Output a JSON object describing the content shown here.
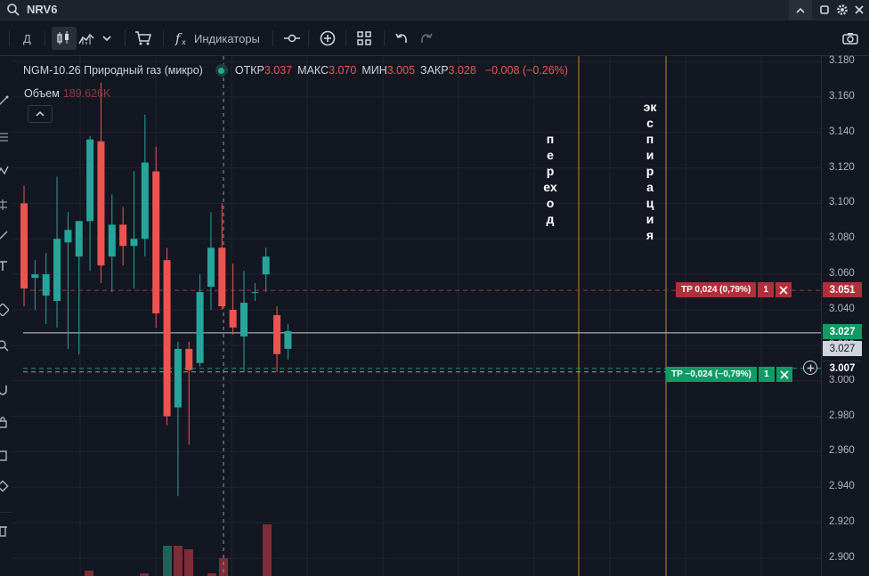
{
  "search": {
    "ticker": "NRV6"
  },
  "toolbar": {
    "interval_label": "Д",
    "indicators_label": "Индикаторы"
  },
  "legend": {
    "instrument": "NGM-10.26 Природный газ (микро)",
    "open_label": "ОТКР",
    "open_value": "3.037",
    "high_label": "МАКС",
    "high_value": "3.070",
    "low_label": "МИН",
    "low_value": "3.005",
    "close_label": "ЗАКР",
    "close_value": "3.028",
    "change": "−0.008 (−0.26%)",
    "volume_label": "Объем",
    "volume_value": "189.626K"
  },
  "annotations": {
    "transition": "переход",
    "expiration": "экспирация"
  },
  "orders": {
    "tp_upper_label": "TP 0,024 (0,79%)",
    "tp_upper_qty": "1",
    "tp_upper_price": "3.051",
    "tp_lower_label": "TP −0,024 (−0,79%)",
    "tp_lower_qty": "1",
    "tp_lower_price": "3.007"
  },
  "price_axis": {
    "ticks": [
      "3.180",
      "3.160",
      "3.140",
      "3.120",
      "3.100",
      "3.080",
      "3.060",
      "3.040",
      "3.020",
      "3.000",
      "2.980",
      "2.960",
      "2.940",
      "2.920",
      "2.900"
    ],
    "last_price": "3.027",
    "crosshair_price": "3.027"
  },
  "colors": {
    "up": "#26a69a",
    "down": "#ef5350",
    "background": "#131722",
    "grid": "#1f2430",
    "transition_line": "#c48a1a",
    "expiration_line": "#c48a1a"
  },
  "chart_data": {
    "type": "candlestick",
    "ylim": [
      2.89,
      3.19
    ],
    "candles": [
      {
        "o": 3.1,
        "h": 3.11,
        "l": 3.042,
        "c": 3.052
      },
      {
        "o": 3.058,
        "h": 3.068,
        "l": 3.04,
        "c": 3.06
      },
      {
        "o": 3.048,
        "h": 3.072,
        "l": 3.032,
        "c": 3.06
      },
      {
        "o": 3.045,
        "h": 3.115,
        "l": 3.03,
        "c": 3.08
      },
      {
        "o": 3.078,
        "h": 3.095,
        "l": 3.018,
        "c": 3.085
      },
      {
        "o": 3.07,
        "h": 3.09,
        "l": 3.015,
        "c": 3.09
      },
      {
        "o": 3.09,
        "h": 3.138,
        "l": 3.062,
        "c": 3.136
      },
      {
        "o": 3.135,
        "h": 3.168,
        "l": 3.055,
        "c": 3.065
      },
      {
        "o": 3.07,
        "h": 3.105,
        "l": 3.05,
        "c": 3.088
      },
      {
        "o": 3.088,
        "h": 3.098,
        "l": 3.065,
        "c": 3.076
      },
      {
        "o": 3.076,
        "h": 3.118,
        "l": 3.052,
        "c": 3.08
      },
      {
        "o": 3.08,
        "h": 3.15,
        "l": 3.07,
        "c": 3.123
      },
      {
        "o": 3.118,
        "h": 3.132,
        "l": 3.03,
        "c": 3.038
      },
      {
        "o": 3.068,
        "h": 3.075,
        "l": 2.975,
        "c": 2.98
      },
      {
        "o": 2.985,
        "h": 3.022,
        "l": 2.935,
        "c": 3.018
      },
      {
        "o": 3.018,
        "h": 3.022,
        "l": 2.964,
        "c": 3.006
      },
      {
        "o": 3.01,
        "h": 3.06,
        "l": 3.008,
        "c": 3.05
      },
      {
        "o": 3.053,
        "h": 3.095,
        "l": 3.04,
        "c": 3.075
      },
      {
        "o": 3.075,
        "h": 3.1,
        "l": 3.04,
        "c": 3.042
      },
      {
        "o": 3.04,
        "h": 3.066,
        "l": 3.026,
        "c": 3.03
      },
      {
        "o": 3.025,
        "h": 3.062,
        "l": 3.005,
        "c": 3.044
      },
      {
        "o": 3.05,
        "h": 3.055,
        "l": 3.045,
        "c": 3.05
      },
      {
        "o": 3.06,
        "h": 3.075,
        "l": 3.05,
        "c": 3.07
      },
      {
        "o": 3.037,
        "h": 3.042,
        "l": 3.005,
        "c": 3.015
      },
      {
        "o": 3.018,
        "h": 3.032,
        "l": 3.012,
        "c": 3.028
      }
    ],
    "price_lines": [
      {
        "name": "tp-upper",
        "price": 3.051,
        "style": "dashed"
      },
      {
        "name": "last-price",
        "price": 3.027,
        "style": "solid"
      },
      {
        "name": "tp-lower",
        "price": 3.007,
        "style": "dashed"
      },
      {
        "name": "entry",
        "price": 3.005,
        "style": "dashed"
      }
    ],
    "grid": true
  }
}
